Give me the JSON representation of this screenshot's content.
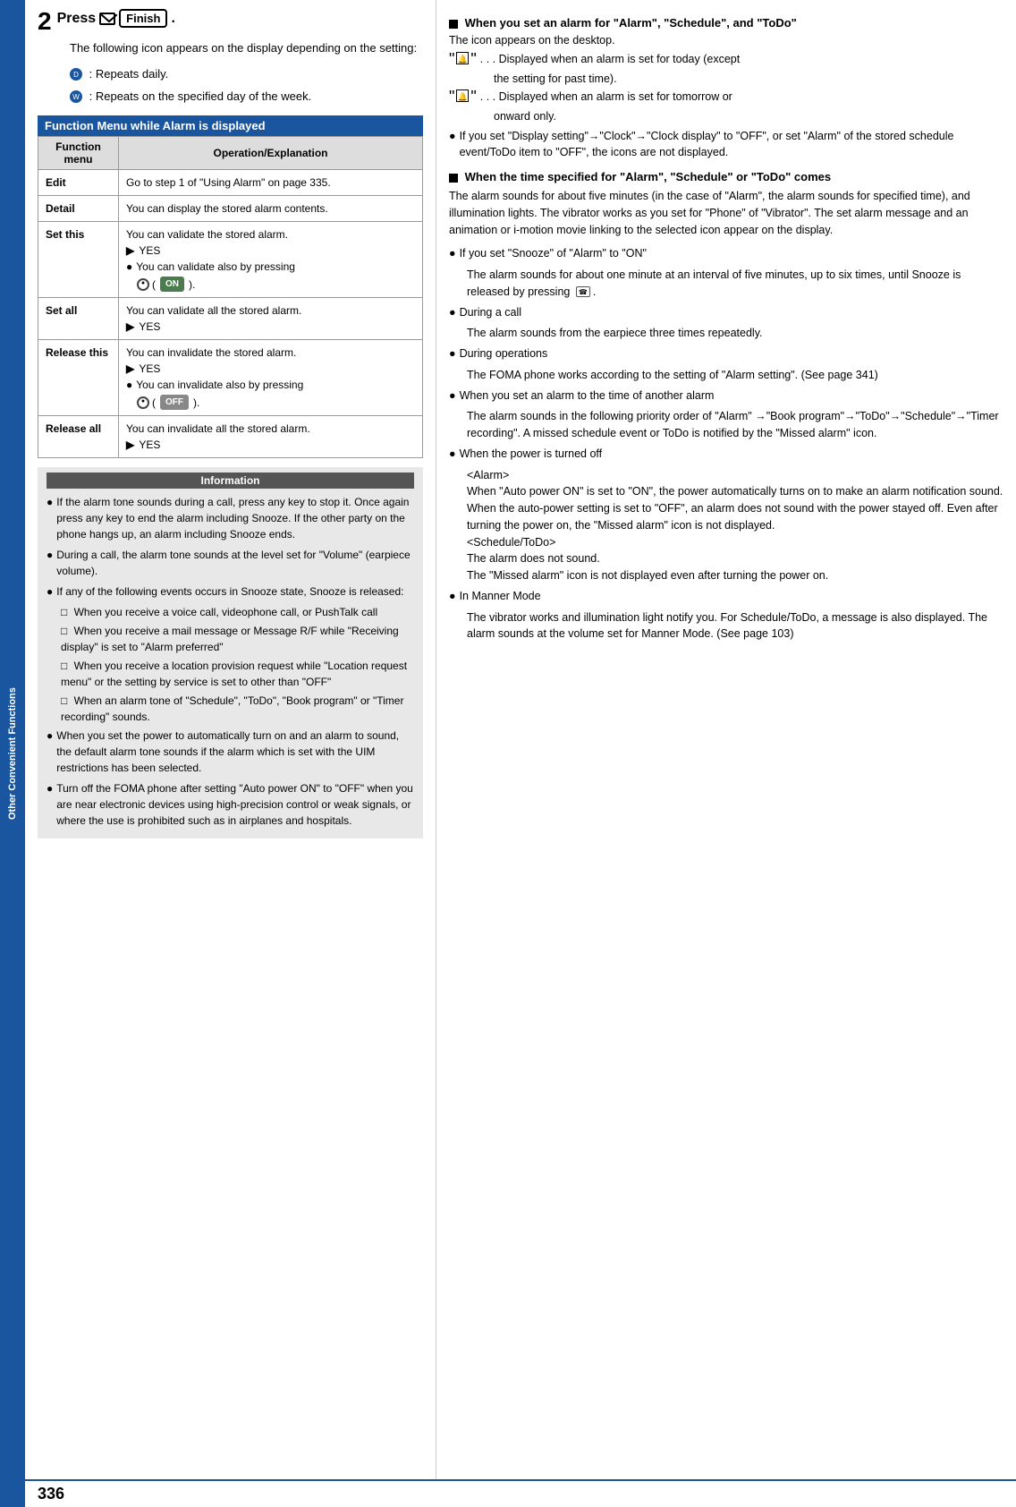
{
  "page": {
    "number": "336",
    "sidebar_label": "Other Convenient Functions"
  },
  "step2": {
    "number": "2",
    "title_prefix": "Press",
    "envelope_label": "✉",
    "finish_label": "Finish",
    "desc": "The following icon appears on the display depending on the setting:",
    "icon1": "D : Repeats daily.",
    "icon2": "W : Repeats on the specified day of the week."
  },
  "function_menu_section": {
    "title": "Function Menu while Alarm is displayed",
    "col1": "Function menu",
    "col2": "Operation/Explanation",
    "rows": [
      {
        "menu": "Edit",
        "desc": "Go to step 1 of \"Using Alarm\" on page 335."
      },
      {
        "menu": "Detail",
        "desc": "You can display the stored alarm contents."
      },
      {
        "menu": "Set this",
        "desc": "You can validate the stored alarm.",
        "arrow": "YES",
        "bullet": "You can validate also by pressing",
        "button": "ON"
      },
      {
        "menu": "Set all",
        "desc": "You can validate all the stored alarm.",
        "arrow": "YES"
      },
      {
        "menu": "Release this",
        "desc": "You can invalidate the stored alarm.",
        "arrow": "YES",
        "bullet": "You can invalidate also by pressing",
        "button": "OFF"
      },
      {
        "menu": "Release all",
        "desc": "You can invalidate all the stored alarm.",
        "arrow": "YES"
      }
    ]
  },
  "information": {
    "title": "Information",
    "items": [
      "If the alarm tone sounds during a call, press any key to stop it. Once again press any key to end the alarm including Snooze. If the other party on the phone hangs up, an alarm including Snooze ends.",
      "During a call, the alarm tone sounds at the level set for \"Volume\" (earpiece volume).",
      "If any of the following events occurs in Snooze state, Snooze is released:",
      "When you set the power to automatically turn on and an alarm to sound, the default alarm tone sounds if the alarm which is set with the UIM restrictions has been selected.",
      "Turn off the FOMA phone after setting \"Auto power ON\" to \"OFF\" when you are near electronic devices using high-precision control or weak signals, or where the use is prohibited such as in airplanes and hospitals."
    ],
    "sub_items": [
      "When you receive a voice call, videophone call, or PushTalk call",
      "When you receive a mail message or Message R/F while \"Receiving display\" is set to \"Alarm preferred\"",
      "When you receive a location provision request while \"Location request menu\" or the setting by service is set to other than \"OFF\"",
      "When an alarm tone of \"Schedule\", \"ToDo\", \"Book program\" or \"Timer recording\" sounds."
    ]
  },
  "right_col": {
    "section1": {
      "title": "When you set an alarm for \"Alarm\", \"Schedule\", and \"ToDo\"",
      "desc": "The icon appears on the desktop.",
      "quote1_prefix": "\"",
      "quote1_icon": "🔔",
      "quote1_suffix": "\" . . . Displayed when an alarm is set for today (except the setting for past time).",
      "quote2_prefix": "\"",
      "quote2_icon": "🔔",
      "quote2_suffix": "\" . . . Displayed when an alarm is set for tomorrow or onward only.",
      "bullets": [
        "If you set \"Display setting\"→\"Clock\"→\"Clock display\" to \"OFF\", or set \"Alarm\" of the stored schedule event/ToDo item to \"OFF\", the icons are not displayed."
      ]
    },
    "section2": {
      "title": "When the time specified for \"Alarm\", \"Schedule\" or \"ToDo\" comes",
      "desc": "The alarm sounds for about five minutes (in the case of \"Alarm\", the alarm sounds for specified time), and illumination lights. The vibrator works as you set for \"Phone\" of \"Vibrator\". The set alarm message and an animation or i-motion movie linking to the selected icon appear on the display.",
      "bullets": [
        {
          "text": "If you set \"Snooze\" of \"Alarm\" to \"ON\"",
          "sub": "The alarm sounds for about one minute at an interval of five minutes, up to six times, until Snooze is released by pressing ☎."
        },
        {
          "text": "During a call",
          "sub": "The alarm sounds from the earpiece three times repeatedly."
        },
        {
          "text": "During operations",
          "sub": "The FOMA phone works according to the setting of \"Alarm setting\". (See page 341)"
        },
        {
          "text": "When you set an alarm to the time of another alarm",
          "sub": "The alarm sounds in the following priority order of \"Alarm\" →\"Book program\"→\"ToDo\"→\"Schedule\"→\"Timer recording\". A missed schedule event or ToDo is notified by the \"Missed alarm\" icon."
        },
        {
          "text": "When the power is turned off",
          "sub_lines": [
            "<Alarm>",
            "When \"Auto power ON\" is set to \"ON\", the power automatically turns on to make an alarm notification sound. When the auto-power setting is set to \"OFF\", an alarm does not sound with the power stayed off. Even after turning the power on, the \"Missed alarm\" icon is not displayed.",
            "<Schedule/ToDo>",
            "The alarm does not sound.",
            "The \"Missed alarm\" icon is not displayed even after turning the power on."
          ]
        },
        {
          "text": "In Manner Mode",
          "sub": "The vibrator works and illumination light notify you. For Schedule/ToDo, a message is also displayed. The alarm sounds at the volume set for Manner Mode. (See page 103)"
        }
      ]
    }
  }
}
